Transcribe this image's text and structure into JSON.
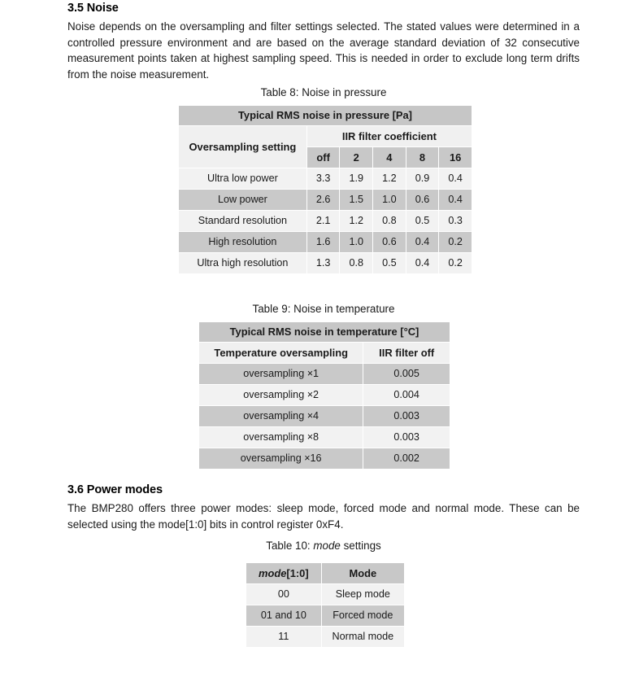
{
  "sections": [
    {
      "number": "3.5",
      "heading": "3.5 Noise",
      "paragraph": "Noise depends on the oversampling and filter settings selected. The stated values were determined in a controlled pressure environment and are based on the average standard deviation of 32 consecutive measurement points taken at highest sampling speed. This is needed in order to exclude long term drifts from the noise measurement."
    },
    {
      "number": "3.6",
      "heading": "3.6 Power modes",
      "paragraph": "The BMP280 offers three power modes: sleep mode, forced mode and normal mode. These can be selected using the mode[1:0] bits in control register 0xF4."
    }
  ],
  "table8": {
    "caption": "Table 8: Noise in pressure",
    "band_header": "Typical RMS noise in pressure [Pa]",
    "row_header_label": "Oversampling setting",
    "group_header": "IIR filter coefficient",
    "sub_headers": [
      "off",
      "2",
      "4",
      "8",
      "16"
    ],
    "rows": [
      {
        "label": "Ultra low power",
        "values": [
          "3.3",
          "1.9",
          "1.2",
          "0.9",
          "0.4"
        ]
      },
      {
        "label": "Low power",
        "values": [
          "2.6",
          "1.5",
          "1.0",
          "0.6",
          "0.4"
        ]
      },
      {
        "label": "Standard resolution",
        "values": [
          "2.1",
          "1.2",
          "0.8",
          "0.5",
          "0.3"
        ]
      },
      {
        "label": "High resolution",
        "values": [
          "1.6",
          "1.0",
          "0.6",
          "0.4",
          "0.2"
        ]
      },
      {
        "label": "Ultra high resolution",
        "values": [
          "1.3",
          "0.8",
          "0.5",
          "0.4",
          "0.2"
        ]
      }
    ]
  },
  "table9": {
    "caption": "Table 9: Noise in temperature",
    "band_header": "Typical RMS noise in temperature [°C]",
    "headers": [
      "Temperature oversampling",
      "IIR filter off"
    ],
    "rows": [
      {
        "label": "oversampling ×1",
        "value": "0.005"
      },
      {
        "label": "oversampling ×2",
        "value": "0.004"
      },
      {
        "label": "oversampling ×4",
        "value": "0.003"
      },
      {
        "label": "oversampling ×8",
        "value": "0.003"
      },
      {
        "label": "oversampling ×16",
        "value": "0.002"
      }
    ]
  },
  "table10": {
    "caption_prefix": "Table 10: ",
    "caption_italic": "mode",
    "caption_suffix": " settings",
    "headers": [
      "mode",
      "[1:0]",
      "Mode"
    ],
    "rows": [
      {
        "bits": "00",
        "mode": "Sleep mode"
      },
      {
        "bits": "01 and 10",
        "mode": "Forced mode"
      },
      {
        "bits": "11",
        "mode": "Normal mode"
      }
    ]
  },
  "colors": {
    "band_header_bg": "#c6c6c6",
    "subhead_light_bg": "#f0f0f0",
    "subhead_mid_bg": "#c8c8c8",
    "row_light_bg": "#f2f2f2",
    "row_dark_bg": "#c9c9c9",
    "page_bg": "#ffffff",
    "text": "#1a1a1a"
  }
}
